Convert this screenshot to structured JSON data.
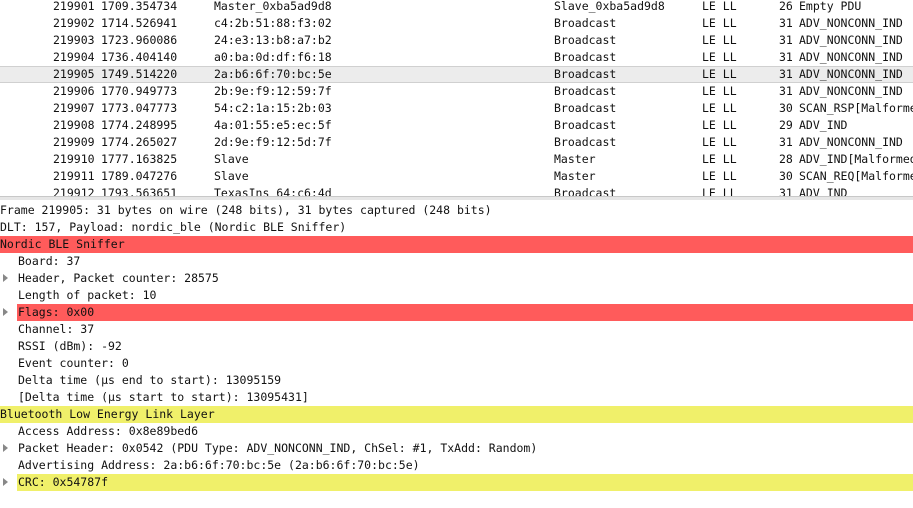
{
  "packet_list": {
    "rows": [
      {
        "no": "219901",
        "time": "1709.354734",
        "src": "Master_0xba5ad9d8",
        "dst": "Slave_0xba5ad9d8",
        "proto": "LE LL",
        "len": "26",
        "info": "Empty PDU",
        "selected": false
      },
      {
        "no": "219902",
        "time": "1714.526941",
        "src": "c4:2b:51:88:f3:02",
        "dst": "Broadcast",
        "proto": "LE LL",
        "len": "31",
        "info": "ADV_NONCONN_IND",
        "selected": false
      },
      {
        "no": "219903",
        "time": "1723.960086",
        "src": "24:e3:13:b8:a7:b2",
        "dst": "Broadcast",
        "proto": "LE LL",
        "len": "31",
        "info": "ADV_NONCONN_IND",
        "selected": false
      },
      {
        "no": "219904",
        "time": "1736.404140",
        "src": "a0:ba:0d:df:f6:18",
        "dst": "Broadcast",
        "proto": "LE LL",
        "len": "31",
        "info": "ADV_NONCONN_IND",
        "selected": false
      },
      {
        "no": "219905",
        "time": "1749.514220",
        "src": "2a:b6:6f:70:bc:5e",
        "dst": "Broadcast",
        "proto": "LE LL",
        "len": "31",
        "info": "ADV_NONCONN_IND",
        "selected": true
      },
      {
        "no": "219906",
        "time": "1770.949773",
        "src": "2b:9e:f9:12:59:7f",
        "dst": "Broadcast",
        "proto": "LE LL",
        "len": "31",
        "info": "ADV_NONCONN_IND",
        "selected": false
      },
      {
        "no": "219907",
        "time": "1773.047773",
        "src": "54:c2:1a:15:2b:03",
        "dst": "Broadcast",
        "proto": "LE LL",
        "len": "30",
        "info": "SCAN_RSP[Malformed",
        "selected": false
      },
      {
        "no": "219908",
        "time": "1774.248995",
        "src": "4a:01:55:e5:ec:5f",
        "dst": "Broadcast",
        "proto": "LE LL",
        "len": "29",
        "info": "ADV_IND",
        "selected": false
      },
      {
        "no": "219909",
        "time": "1774.265027",
        "src": "2d:9e:f9:12:5d:7f",
        "dst": "Broadcast",
        "proto": "LE LL",
        "len": "31",
        "info": "ADV_NONCONN_IND",
        "selected": false
      },
      {
        "no": "219910",
        "time": "1777.163825",
        "src": "Slave",
        "dst": "Master",
        "proto": "LE LL",
        "len": "28",
        "info": "ADV_IND[Malformed",
        "selected": false
      },
      {
        "no": "219911",
        "time": "1789.047276",
        "src": "Slave",
        "dst": "Master",
        "proto": "LE LL",
        "len": "30",
        "info": "SCAN_REQ[Malformed",
        "selected": false
      },
      {
        "no": "219912",
        "time": "1793.563651",
        "src": "TexasIns_64:c6:4d",
        "dst": "Broadcast",
        "proto": "LE LL",
        "len": "31",
        "info": "ADV_IND",
        "selected": false
      }
    ]
  },
  "details": {
    "lines": [
      {
        "text": "Frame 219905: 31 bytes on wire (248 bits), 31 bytes captured (248 bits)",
        "level": 0,
        "hl": "",
        "expander": false
      },
      {
        "text": "DLT: 157, Payload: nordic_ble (Nordic BLE Sniffer)",
        "level": 0,
        "hl": "",
        "expander": false
      },
      {
        "text": "Nordic BLE Sniffer",
        "level": 0,
        "hl": "red",
        "expander": false
      },
      {
        "text": "Board: 37",
        "level": 1,
        "hl": "",
        "expander": false
      },
      {
        "text": "Header, Packet counter: 28575",
        "level": 1,
        "hl": "",
        "expander": true
      },
      {
        "text": "Length of packet: 10",
        "level": 1,
        "hl": "",
        "expander": false
      },
      {
        "text": "Flags: 0x00",
        "level": 1,
        "hl": "red",
        "expander": true
      },
      {
        "text": "Channel: 37",
        "level": 1,
        "hl": "",
        "expander": false
      },
      {
        "text": "RSSI (dBm): -92",
        "level": 1,
        "hl": "",
        "expander": false
      },
      {
        "text": "Event counter: 0",
        "level": 1,
        "hl": "",
        "expander": false
      },
      {
        "text": "Delta time (µs end to start): 13095159",
        "level": 1,
        "hl": "",
        "expander": false
      },
      {
        "text": "[Delta time (µs start to start): 13095431]",
        "level": 1,
        "hl": "",
        "expander": false
      },
      {
        "text": "Bluetooth Low Energy Link Layer",
        "level": 0,
        "hl": "yellow",
        "expander": false
      },
      {
        "text": "Access Address: 0x8e89bed6",
        "level": 1,
        "hl": "",
        "expander": false
      },
      {
        "text": "Packet Header: 0x0542 (PDU Type: ADV_NONCONN_IND, ChSel: #1, TxAdd: Random)",
        "level": 1,
        "hl": "",
        "expander": true
      },
      {
        "text": "Advertising Address: 2a:b6:6f:70:bc:5e (2a:b6:6f:70:bc:5e)",
        "level": 1,
        "hl": "",
        "expander": false
      },
      {
        "text": "CRC: 0x54787f",
        "level": 1,
        "hl": "yellow",
        "expander": true
      }
    ]
  },
  "colors": {
    "highlight_red": "#ff5b5b",
    "highlight_yellow": "#f0f06a",
    "selected_row": "#ececec"
  },
  "icons": {
    "expander": "triangle-right-icon"
  }
}
